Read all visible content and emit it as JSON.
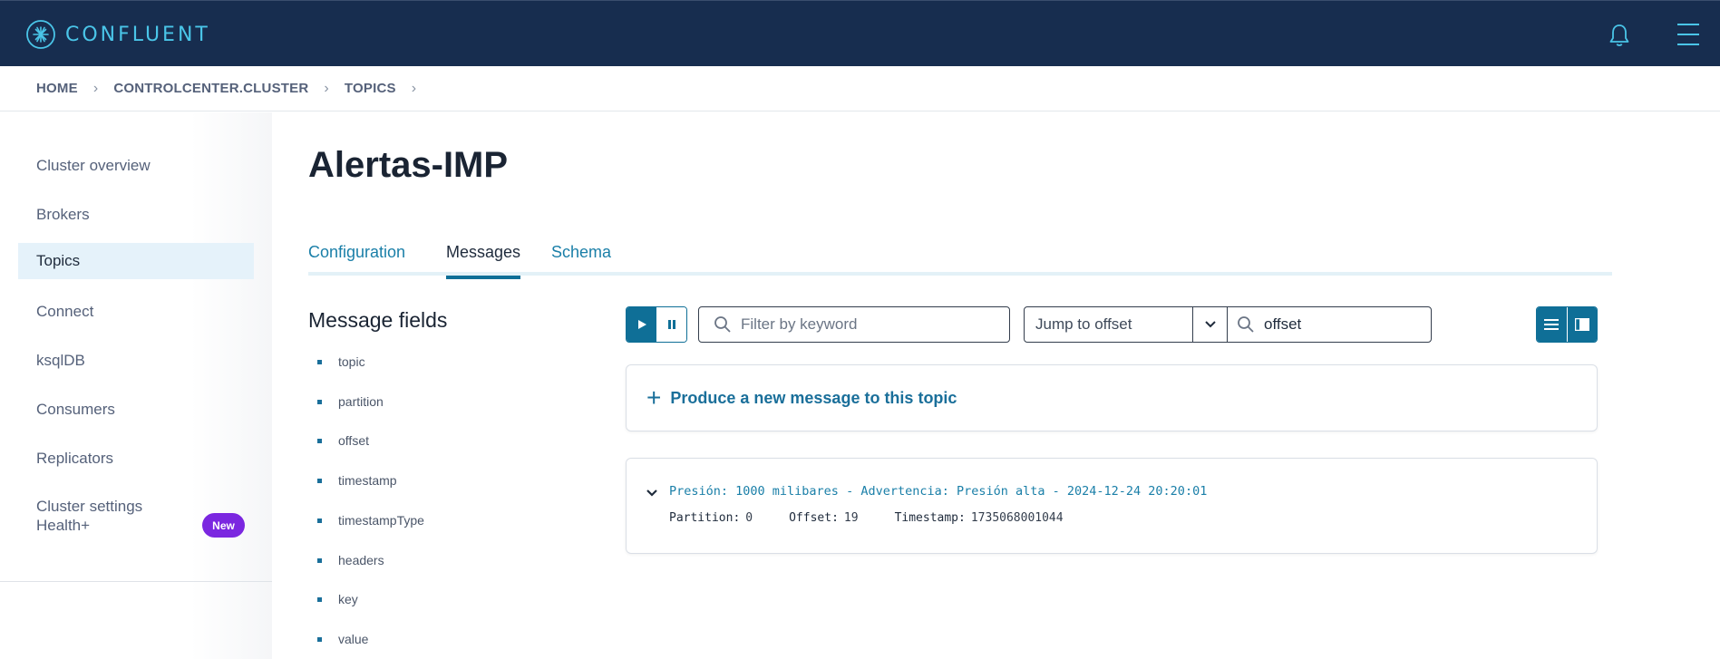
{
  "brand": {
    "name": "CONFLUENT"
  },
  "topbar": {
    "bell_icon": "bell-icon",
    "menu_icon": "hamburger-menu-icon"
  },
  "breadcrumb": {
    "items": [
      "HOME",
      "CONTROLCENTER.CLUSTER",
      "TOPICS"
    ],
    "separator": "›"
  },
  "sidebar": {
    "items": [
      {
        "label": "Cluster overview",
        "active": false
      },
      {
        "label": "Brokers",
        "active": false
      },
      {
        "label": "Topics",
        "active": true
      },
      {
        "label": "Connect",
        "active": false
      },
      {
        "label": "ksqlDB",
        "active": false
      },
      {
        "label": "Consumers",
        "active": false
      },
      {
        "label": "Replicators",
        "active": false
      },
      {
        "label": "Cluster settings",
        "active": false
      }
    ],
    "health": {
      "label": "Health+",
      "badge": "New"
    }
  },
  "page": {
    "title": "Alertas-IMP"
  },
  "tabs": [
    {
      "label": "Configuration",
      "active": false
    },
    {
      "label": "Messages",
      "active": true
    },
    {
      "label": "Schema",
      "active": false
    }
  ],
  "message_fields": {
    "title": "Message fields",
    "items": [
      "topic",
      "partition",
      "offset",
      "timestamp",
      "timestampType",
      "headers",
      "key",
      "value"
    ]
  },
  "controls": {
    "filter_placeholder": "Filter by keyword",
    "jump_label": "Jump to offset",
    "offset_value": "offset"
  },
  "produce": {
    "label": "Produce a new message to this topic"
  },
  "messages": [
    {
      "value": "Presión: 1000 milibares - Advertencia: Presión alta - 2024-12-24 20:20:01",
      "partition_label": "Partition:",
      "partition": "0",
      "offset_label": "Offset:",
      "offset": "19",
      "timestamp_label": "Timestamp:",
      "timestamp": "1735068001044"
    }
  ],
  "colors": {
    "topbar": "#172d4f",
    "accent": "#0f6f97",
    "link": "#1a7fa8",
    "badge": "#7b27e0"
  }
}
